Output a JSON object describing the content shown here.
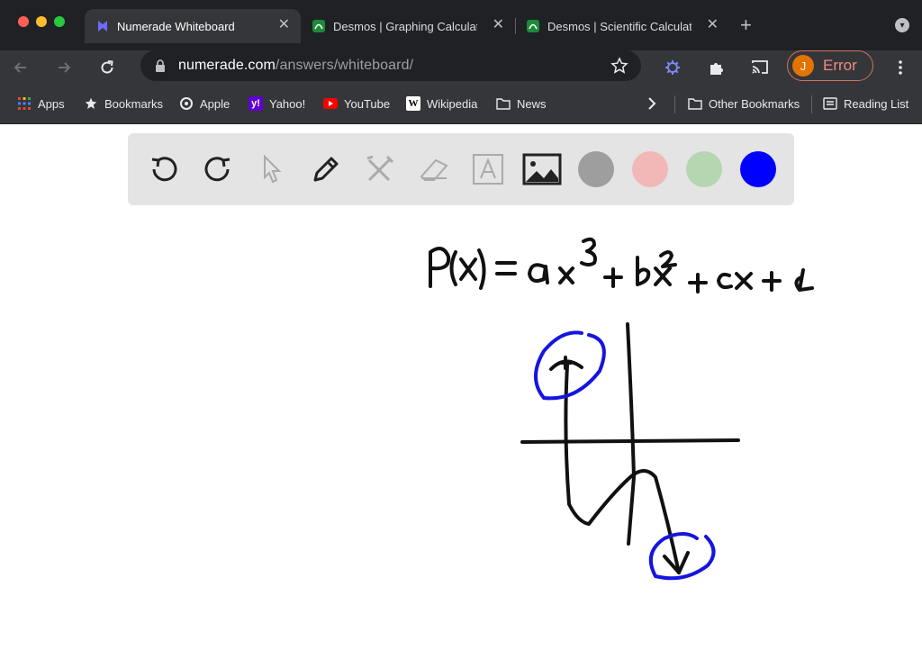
{
  "window": {
    "tabs": [
      {
        "title": "Numerade Whiteboard",
        "icon": "numerade-favicon",
        "active": true
      },
      {
        "title": "Desmos | Graphing Calculator",
        "icon": "desmos-favicon",
        "active": false
      },
      {
        "title": "Desmos | Scientific Calculator",
        "icon": "desmos-favicon",
        "active": false
      }
    ]
  },
  "toolbar": {
    "url_domain": "numerade.com",
    "url_path": "/answers/whiteboard/",
    "profile_initial": "J",
    "profile_status": "Error"
  },
  "bookmarks": {
    "items": [
      {
        "label": "Apps",
        "icon": "apps-grid-icon"
      },
      {
        "label": "Bookmarks",
        "icon": "star-icon"
      },
      {
        "label": "Apple",
        "icon": "apple-icon"
      },
      {
        "label": "Yahoo!",
        "icon": "yahoo-icon"
      },
      {
        "label": "YouTube",
        "icon": "youtube-icon"
      },
      {
        "label": "Wikipedia",
        "icon": "wikipedia-icon"
      },
      {
        "label": "News",
        "icon": "folder-icon"
      }
    ],
    "other": "Other Bookmarks",
    "reading_list": "Reading List"
  },
  "whiteboard": {
    "tools": [
      "undo-icon",
      "redo-icon",
      "pointer-icon",
      "pen-icon",
      "tools-icon",
      "eraser-icon",
      "text-icon",
      "image-icon"
    ],
    "colors": [
      "#9e9e9e",
      "#f2b8b8",
      "#b4d6b0",
      "#0000ff"
    ],
    "selected_color": "#0000ff"
  },
  "colors": {
    "chrome_bg": "#202124",
    "toolbar_bg": "#35363a",
    "ink": "#111111",
    "highlight": "#1515e0"
  }
}
